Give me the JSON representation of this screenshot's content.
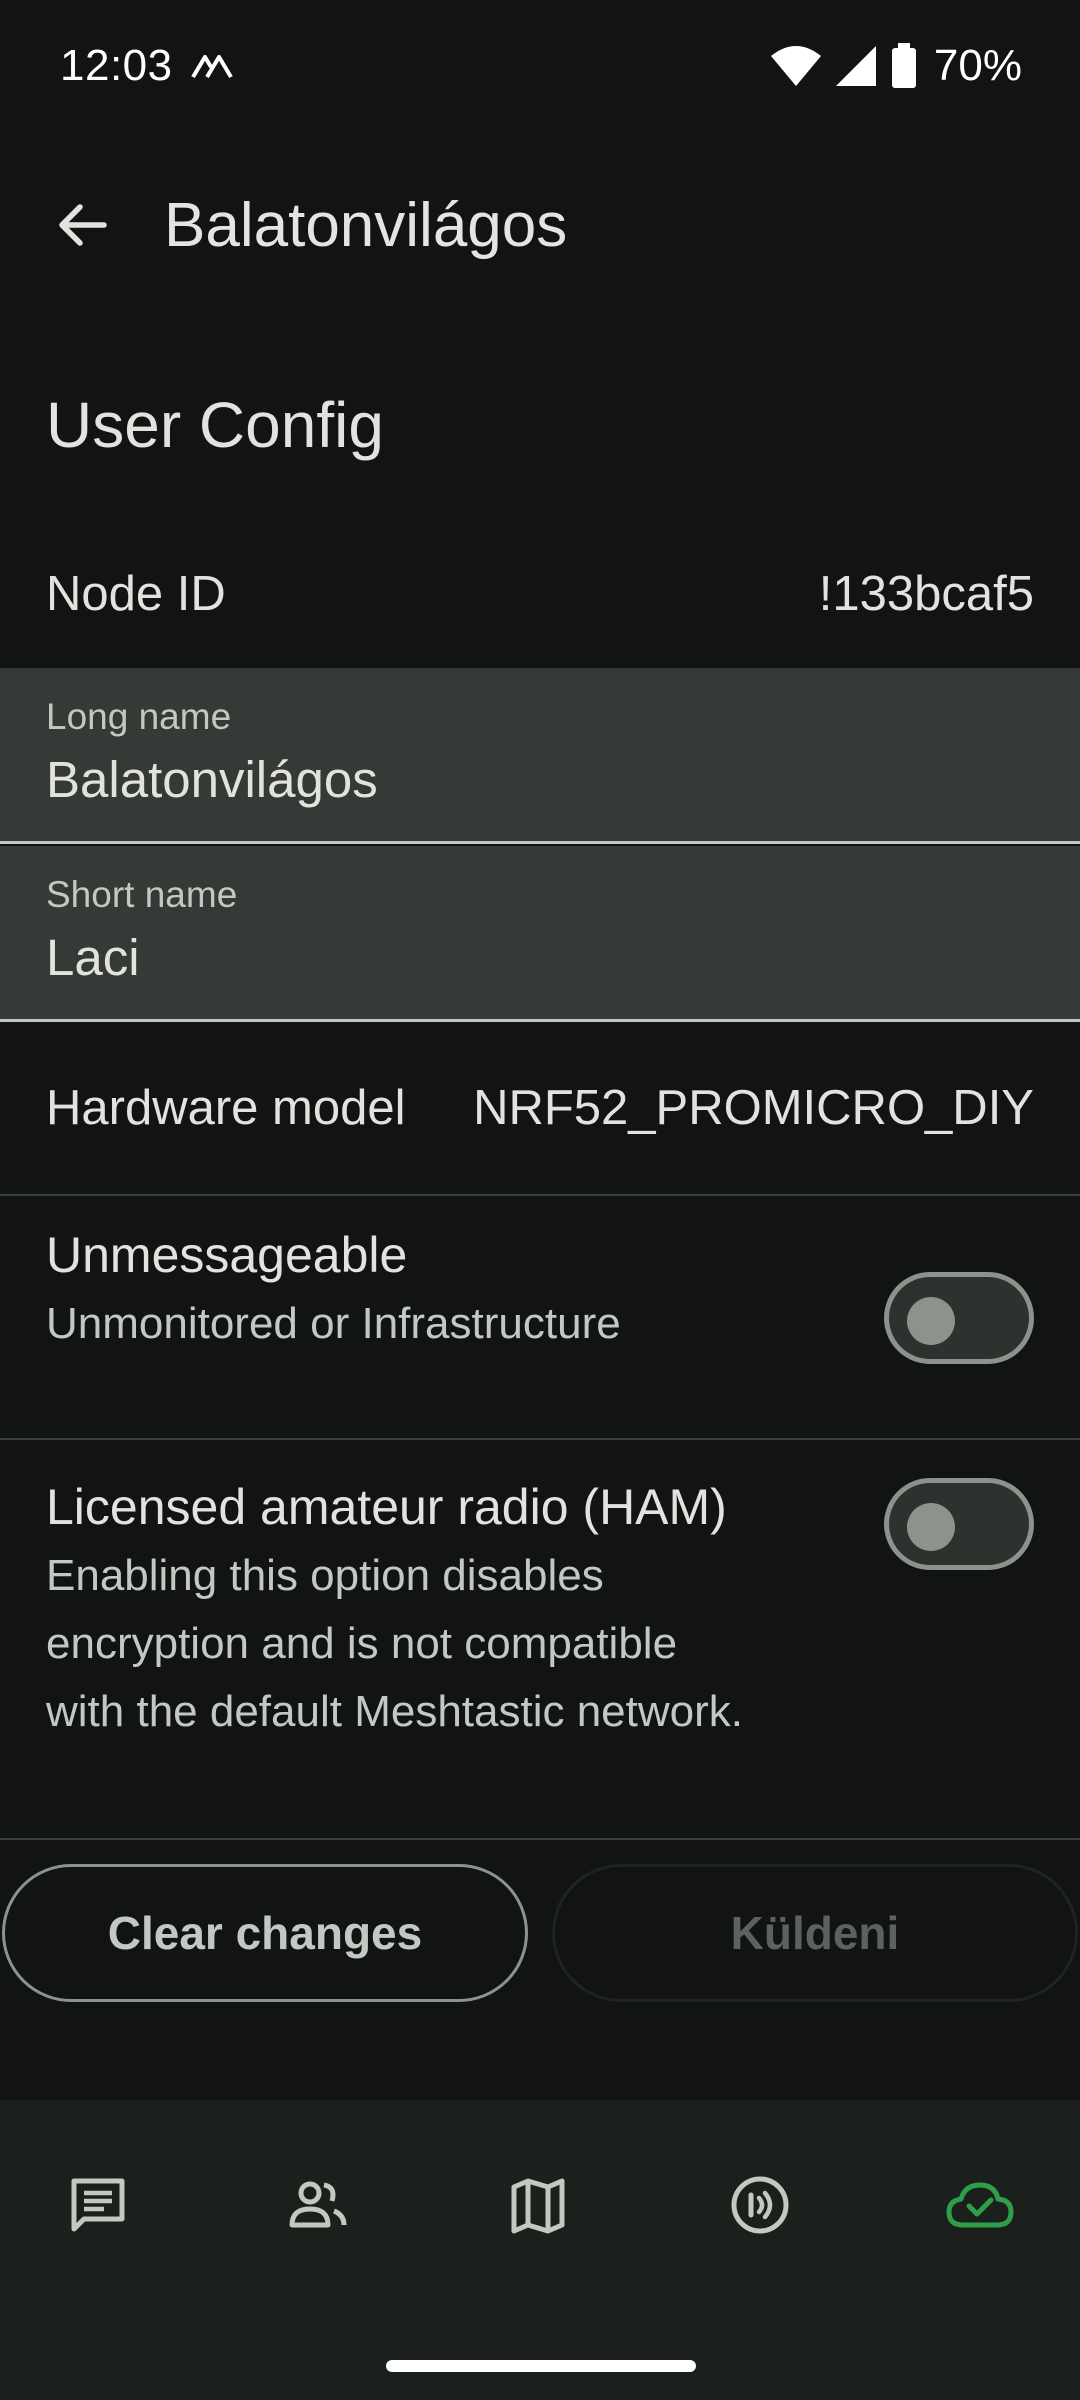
{
  "status_bar": {
    "time": "12:03",
    "battery": "70%",
    "icons": [
      "mesh-notification-icon",
      "wifi-icon",
      "cell-signal-icon",
      "battery-icon"
    ]
  },
  "app_bar": {
    "title": "Balatonvilágos",
    "back_icon": "arrow-back-icon"
  },
  "section": {
    "title": "User Config"
  },
  "node_id": {
    "label": "Node ID",
    "value": "!133bcaf5"
  },
  "long_name": {
    "label": "Long name",
    "value": "Balatonvilágos"
  },
  "short_name": {
    "label": "Short name",
    "value": "Laci"
  },
  "hardware_model": {
    "label": "Hardware model",
    "value": "NRF52_PROMICRO_DIY"
  },
  "unmessageable": {
    "title": "Unmessageable",
    "subtitle": "Unmonitored or Infrastructure",
    "enabled": false
  },
  "ham": {
    "title": "Licensed amateur radio (HAM)",
    "subtitle_lines": [
      "Enabling this option disables",
      "encryption and is not compatible",
      "with the default Meshtastic network."
    ],
    "enabled": false
  },
  "buttons": {
    "clear": "Clear changes",
    "send": "Küldeni"
  },
  "bottom_nav": {
    "items": [
      {
        "icon": "messages-icon",
        "active": false
      },
      {
        "icon": "nodes-icon",
        "active": false
      },
      {
        "icon": "map-icon",
        "active": false
      },
      {
        "icon": "connection-icon",
        "active": false
      },
      {
        "icon": "cloud-check-icon",
        "active": true
      }
    ]
  },
  "colors": {
    "background": "#111412",
    "field_background": "#353a36",
    "active_accent": "#2e9e48",
    "inactive_icon": "#c4c8c2"
  }
}
